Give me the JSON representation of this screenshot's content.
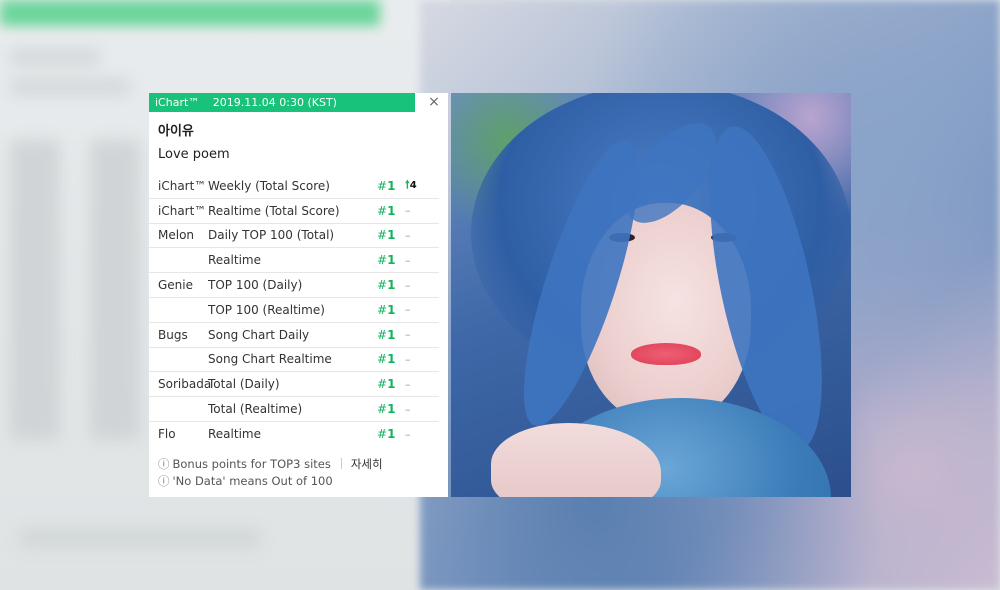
{
  "widget": {
    "brand": "iChart™",
    "timestamp": "2019.11.04 0:30 (KST)",
    "close_label": "×",
    "artist": "아이유",
    "song": "Love poem",
    "rows": [
      {
        "site": "iChart™",
        "chart": "Weekly (Total Score)",
        "hash": "#",
        "rank": "1",
        "change_icon": "up-arrow-icon",
        "change": "4"
      },
      {
        "site": "iChart™",
        "chart": "Realtime (Total Score)",
        "hash": "#",
        "rank": "1",
        "change": "–"
      },
      {
        "site": "Melon",
        "chart": "Daily TOP 100 (Total)",
        "hash": "#",
        "rank": "1",
        "change": "–"
      },
      {
        "site": "",
        "chart": "Realtime",
        "hash": "#",
        "rank": "1",
        "change": "–"
      },
      {
        "site": "Genie",
        "chart": "TOP 100 (Daily)",
        "hash": "#",
        "rank": "1",
        "change": "–"
      },
      {
        "site": "",
        "chart": "TOP 100 (Realtime)",
        "hash": "#",
        "rank": "1",
        "change": "–"
      },
      {
        "site": "Bugs",
        "chart": "Song Chart Daily",
        "hash": "#",
        "rank": "1",
        "change": "–"
      },
      {
        "site": "",
        "chart": "Song Chart Realtime",
        "hash": "#",
        "rank": "1",
        "change": "–"
      },
      {
        "site": "Soribada",
        "chart": "Total (Daily)",
        "hash": "#",
        "rank": "1",
        "change": "–"
      },
      {
        "site": "",
        "chart": "Total (Realtime)",
        "hash": "#",
        "rank": "1",
        "change": "–"
      },
      {
        "site": "Flo",
        "chart": "Realtime",
        "hash": "#",
        "rank": "1",
        "change": "–"
      }
    ],
    "footer": {
      "info_icon": "ⓘ",
      "note1": "Bonus points for TOP3 sites",
      "details_link": "자세히",
      "note2": "'No Data' means Out of 100"
    }
  },
  "colors": {
    "header_green": "#19c27a",
    "rank_green": "#14b25f"
  }
}
